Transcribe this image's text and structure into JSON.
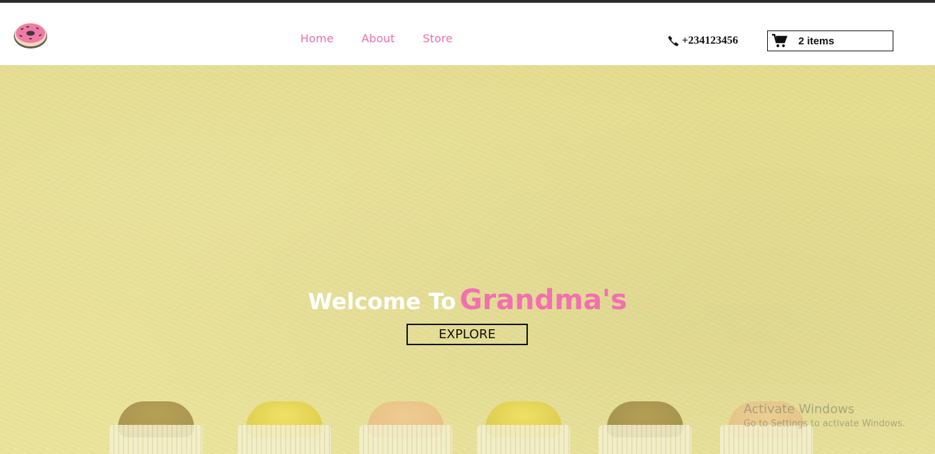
{
  "header": {
    "logo_icon": "donut-icon",
    "nav": [
      {
        "label": "Home"
      },
      {
        "label": "About"
      },
      {
        "label": "Store"
      }
    ],
    "phone": {
      "icon": "phone-icon",
      "number": "+234123456"
    },
    "cart": {
      "icon": "cart-icon",
      "label": "2 items"
    }
  },
  "hero": {
    "welcome_prefix": "Welcome To",
    "brand": "Grandma's",
    "explore_label": "EXPLORE"
  },
  "watermark": {
    "line1": "Activate Windows",
    "line2": "Go to Settings to activate Windows."
  },
  "colors": {
    "accent_pink": "#f36fb0",
    "hero_yellow": "#e7df92"
  }
}
